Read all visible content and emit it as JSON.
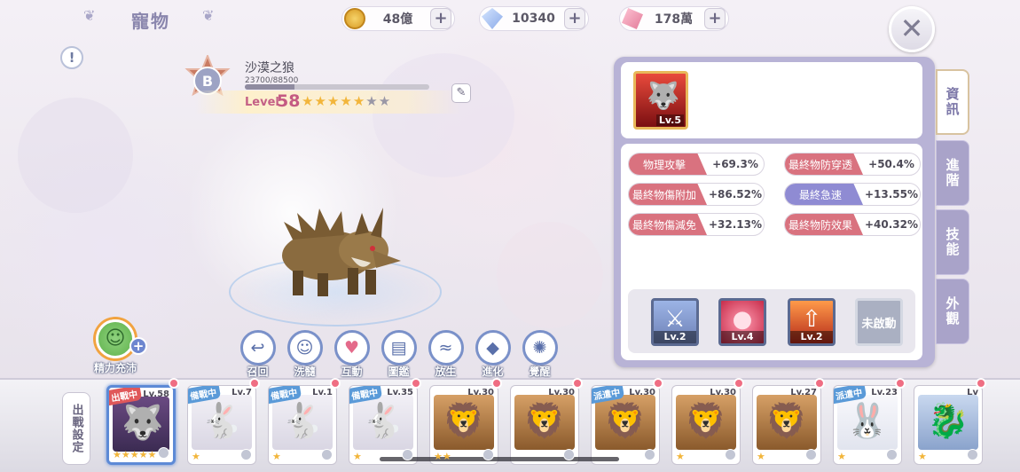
{
  "header": {
    "title": "寵物",
    "resources": [
      {
        "icon": "gold-coin-icon",
        "value": "48億",
        "color": "#e8b23a"
      },
      {
        "icon": "diamond-icon",
        "value": "10340",
        "color": "#7aa5e6"
      },
      {
        "icon": "crystal-icon",
        "value": "178萬",
        "color": "#e88aa6"
      }
    ]
  },
  "pet": {
    "grade": "B",
    "name": "沙漠之狼",
    "exp_text": "23700/88500",
    "exp_fraction": 0.268,
    "level_label": "Level",
    "level": "58",
    "stars_filled": 5,
    "stars_total": 7
  },
  "actions": [
    {
      "label": "召回",
      "icon": "recall-icon",
      "glyph": "↩"
    },
    {
      "label": "洗髓",
      "icon": "wash-icon",
      "glyph": "☺"
    },
    {
      "label": "互動",
      "icon": "heart-icon",
      "glyph": "♥"
    },
    {
      "label": "圖鑑",
      "icon": "book-icon",
      "glyph": "▤"
    },
    {
      "label": "放生",
      "icon": "release-icon",
      "glyph": "≈"
    },
    {
      "label": "進化",
      "icon": "crystal-evolve-icon",
      "glyph": "◆"
    },
    {
      "label": "覺醒",
      "icon": "awaken-icon",
      "glyph": "✺"
    }
  ],
  "energy": {
    "label": "精力充沛"
  },
  "panel": {
    "main_skill_level": "Lv.5",
    "stats_left": [
      {
        "name": "物理攻擊",
        "value": "+69.3%",
        "color": "red"
      },
      {
        "name": "最終物傷附加",
        "value": "+86.52%",
        "color": "red"
      },
      {
        "name": "最終物傷減免",
        "value": "+32.13%",
        "color": "red"
      }
    ],
    "stats_right": [
      {
        "name": "最終物防穿透",
        "value": "+50.4%",
        "color": "red"
      },
      {
        "name": "最終急速",
        "value": "+13.55%",
        "color": "purple"
      },
      {
        "name": "最終物防效果",
        "value": "+40.32%",
        "color": "red"
      }
    ],
    "skills": [
      {
        "level": "Lv.2",
        "icon": "sword-slash-icon"
      },
      {
        "level": "Lv.4",
        "icon": "fire-orb-icon"
      },
      {
        "level": "Lv.2",
        "icon": "flame-up-icon"
      }
    ],
    "locked_label": "未啟動"
  },
  "tabs": [
    "資訊",
    "進階",
    "技能",
    "外觀"
  ],
  "bottom": {
    "deploy_label": "出戰設定",
    "cards": [
      {
        "level": "Lv.58",
        "status": "出戰中",
        "status_color": "red",
        "stars": "★★★★★",
        "creature": "wolf",
        "selected": true
      },
      {
        "level": "Lv.7",
        "status": "備戰中",
        "status_color": "blue",
        "stars": "★",
        "creature": "bunny"
      },
      {
        "level": "Lv.1",
        "status": "備戰中",
        "status_color": "blue",
        "stars": "★",
        "creature": "bunny"
      },
      {
        "level": "Lv.35",
        "status": "備戰中",
        "status_color": "blue",
        "stars": "★",
        "creature": "bunny"
      },
      {
        "level": "Lv.30",
        "status": "",
        "stars": "★★",
        "creature": "lion"
      },
      {
        "level": "Lv.30",
        "status": "",
        "stars": "",
        "creature": "lion"
      },
      {
        "level": "Lv.30",
        "status": "派遣中",
        "status_color": "blue",
        "stars": "",
        "creature": "lion"
      },
      {
        "level": "Lv.30",
        "status": "",
        "stars": "★",
        "creature": "lion"
      },
      {
        "level": "Lv.27",
        "status": "",
        "stars": "★",
        "creature": "lion"
      },
      {
        "level": "Lv.23",
        "status": "派遣中",
        "status_color": "blue",
        "stars": "★",
        "creature": "white-bunny"
      },
      {
        "level": "Lv",
        "status": "",
        "stars": "★",
        "creature": "dragon"
      }
    ]
  }
}
